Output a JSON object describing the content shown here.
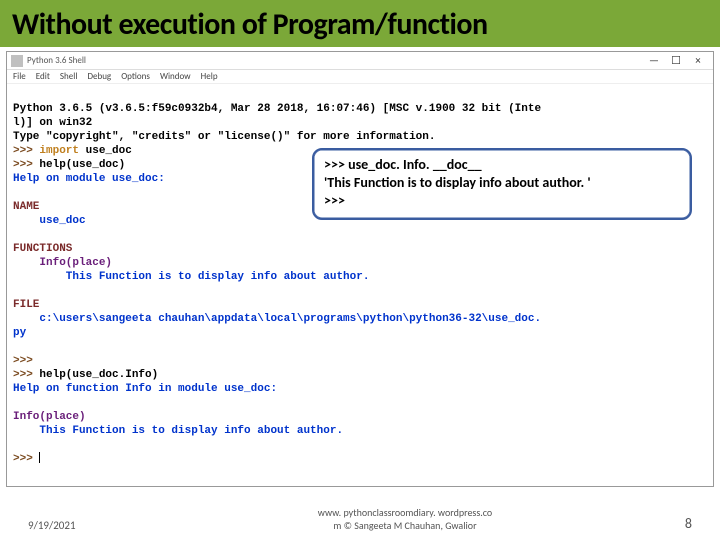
{
  "title": "Without execution of Program/function",
  "window": {
    "title": "Python 3.6 Shell",
    "menu": [
      "File",
      "Edit",
      "Shell",
      "Debug",
      "Options",
      "Window",
      "Help"
    ]
  },
  "console": {
    "banner1": "Python 3.6.5 (v3.6.5:f59c0932b4, Mar 28 2018, 16:07:46) [MSC v.1900 32 bit (Inte",
    "banner2": "l)] on win32",
    "banner3": "Type \"copyright\", \"credits\" or \"license()\" for more information.",
    "p1": ">>> ",
    "import_kw": "import",
    "import_mod": " use_doc",
    "p2": ">>> ",
    "help1": "help(use_doc)",
    "help_header1": "Help on module use_doc:",
    "name_lbl": "NAME",
    "name_val": "    use_doc",
    "funcs_lbl": "FUNCTIONS",
    "func_sig": "    Info(place)",
    "func_doc": "        This Function is to display info about author.",
    "file_lbl": "FILE",
    "file_path": "    c:\\users\\sangeeta chauhan\\appdata\\local\\programs\\python\\python36-32\\use_doc.",
    "file_ext": "py",
    "p3": ">>> ",
    "p4": ">>> ",
    "help2": "help(use_doc.Info)",
    "help_header2": "Help on function Info in module use_doc:",
    "info_sig": "Info(place)",
    "info_doc": "    This Function is to display info about author.",
    "p5": ">>> "
  },
  "callout": {
    "line1": ">>> use_doc. Info. __doc__",
    "line2": "'This Function is to display info about author. '",
    "line3": ">>>"
  },
  "footer": {
    "date": "9/19/2021",
    "center1": "www. pythonclassroomdiary. wordpress.co",
    "center2": "m   © Sangeeta M Chauhan, Gwalior",
    "page": "8"
  }
}
